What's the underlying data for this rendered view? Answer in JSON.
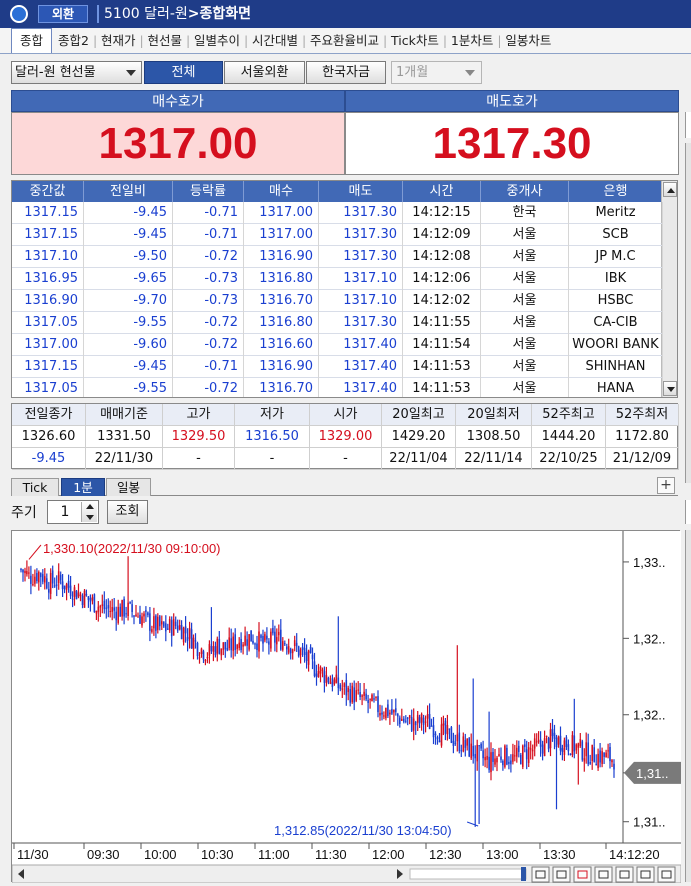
{
  "title_bar": {
    "tag": "외환",
    "code_title": "5100 달러-원",
    "screen": "종합화면"
  },
  "tabs": [
    {
      "label": "종합",
      "active": true
    },
    {
      "label": "종합2"
    },
    {
      "label": "현재가"
    },
    {
      "label": "현선물"
    },
    {
      "label": "일별추이"
    },
    {
      "label": "시간대별"
    },
    {
      "label": "주요환율비교"
    },
    {
      "label": "Tick차트"
    },
    {
      "label": "1분차트"
    },
    {
      "label": "일봉차트"
    }
  ],
  "toolbar": {
    "instrument": "달러-원 현선물",
    "segments": [
      "전체",
      "서울외환",
      "한국자금"
    ],
    "period": "1개월"
  },
  "quote": {
    "bid_label": "매수호가",
    "bid_price": "1317.00",
    "ask_label": "매도호가",
    "ask_price": "1317.30"
  },
  "trades": {
    "headers": [
      "중간값",
      "전일비",
      "등락률",
      "매수",
      "매도",
      "시간",
      "중개사",
      "은행"
    ],
    "rows": [
      [
        "1317.15",
        "-9.45",
        "-0.71",
        "1317.00",
        "1317.30",
        "14:12:15",
        "한국",
        "Meritz"
      ],
      [
        "1317.15",
        "-9.45",
        "-0.71",
        "1317.00",
        "1317.30",
        "14:12:09",
        "서울",
        "SCB"
      ],
      [
        "1317.10",
        "-9.50",
        "-0.72",
        "1316.90",
        "1317.30",
        "14:12:08",
        "서울",
        "JP M.C"
      ],
      [
        "1316.95",
        "-9.65",
        "-0.73",
        "1316.80",
        "1317.10",
        "14:12:06",
        "서울",
        "IBK"
      ],
      [
        "1316.90",
        "-9.70",
        "-0.73",
        "1316.70",
        "1317.10",
        "14:12:02",
        "서울",
        "HSBC"
      ],
      [
        "1317.05",
        "-9.55",
        "-0.72",
        "1316.80",
        "1317.30",
        "14:11:55",
        "서울",
        "CA-CIB"
      ],
      [
        "1317.00",
        "-9.60",
        "-0.72",
        "1316.60",
        "1317.40",
        "14:11:54",
        "서울",
        "WOORI BANK"
      ],
      [
        "1317.15",
        "-9.45",
        "-0.71",
        "1316.90",
        "1317.40",
        "14:11:53",
        "서울",
        "SHINHAN"
      ],
      [
        "1317.05",
        "-9.55",
        "-0.72",
        "1316.70",
        "1317.40",
        "14:11:53",
        "서울",
        "HANA"
      ]
    ]
  },
  "summary": {
    "headers": [
      "전일종가",
      "매매기준",
      "고가",
      "저가",
      "시가",
      "20일최고",
      "20일최저",
      "52주최고",
      "52주최저"
    ],
    "values": [
      "1326.60",
      "1331.50",
      "1329.50",
      "1316.50",
      "1329.00",
      "1429.20",
      "1308.50",
      "1444.20",
      "1172.80"
    ],
    "row3": [
      "-9.45",
      "22/11/30",
      "-",
      "-",
      "-",
      "22/11/04",
      "22/11/14",
      "22/10/25",
      "21/12/09"
    ]
  },
  "chart_tabs": [
    {
      "label": "Tick"
    },
    {
      "label": "1분",
      "active": true
    },
    {
      "label": "일봉"
    }
  ],
  "period_control": {
    "label": "주기",
    "value": "1",
    "query_label": "조회"
  },
  "colors": {
    "up": "#d50f1e",
    "down": "#1a3fd0",
    "header_blue": "#4169b6",
    "title_blue": "#1f3c88"
  },
  "chart_data": {
    "type": "candlestick",
    "x_tick_labels": [
      "11/30",
      "09:30",
      "10:00",
      "10:30",
      "11:00",
      "11:30",
      "12:00",
      "12:30",
      "13:00",
      "13:30",
      "14:12:20"
    ],
    "y_tick_labels": [
      "1,33..",
      "1,32..",
      "1,32..",
      "1,31..",
      "1,31.."
    ],
    "ylim": [
      1312.0,
      1331.5
    ],
    "current_price_label": "1,31..",
    "high_annotation": "1,330.10(2022/11/30 09:10:00)",
    "low_annotation": "1,312.85(2022/11/30 13:04:50)",
    "high": 1330.1,
    "low": 1312.85,
    "close_path": [
      [
        0,
        1329.5
      ],
      [
        3,
        1329.0
      ],
      [
        6,
        1329.3
      ],
      [
        9,
        1328.6
      ],
      [
        12,
        1328.8
      ],
      [
        15,
        1328.4
      ],
      [
        18,
        1328.0
      ],
      [
        22,
        1327.5
      ],
      [
        26,
        1327.0
      ],
      [
        30,
        1326.8
      ],
      [
        34,
        1326.9
      ],
      [
        38,
        1326.5
      ],
      [
        42,
        1325.9
      ],
      [
        46,
        1325.6
      ],
      [
        50,
        1325.9
      ],
      [
        54,
        1325.2
      ],
      [
        57,
        1324.4
      ],
      [
        60,
        1324.0
      ],
      [
        63,
        1324.6
      ],
      [
        66,
        1324.3
      ],
      [
        70,
        1324.9
      ],
      [
        74,
        1325.1
      ],
      [
        78,
        1324.6
      ],
      [
        82,
        1325.0
      ],
      [
        86,
        1324.7
      ],
      [
        90,
        1324.0
      ],
      [
        94,
        1323.1
      ],
      [
        98,
        1322.5
      ],
      [
        102,
        1321.8
      ],
      [
        106,
        1321.4
      ],
      [
        110,
        1320.9
      ],
      [
        114,
        1320.5
      ],
      [
        118,
        1320.2
      ],
      [
        122,
        1319.7
      ],
      [
        126,
        1319.4
      ],
      [
        130,
        1319.6
      ],
      [
        134,
        1318.9
      ],
      [
        138,
        1318.5
      ],
      [
        142,
        1318.0
      ],
      [
        146,
        1317.4
      ],
      [
        150,
        1316.9
      ],
      [
        154,
        1317.4
      ],
      [
        158,
        1317.1
      ],
      [
        162,
        1317.6
      ],
      [
        166,
        1317.9
      ],
      [
        170,
        1318.4
      ],
      [
        174,
        1318.2
      ],
      [
        178,
        1317.9
      ],
      [
        182,
        1317.4
      ],
      [
        186,
        1317.3
      ],
      [
        190,
        1317.1
      ]
    ]
  }
}
